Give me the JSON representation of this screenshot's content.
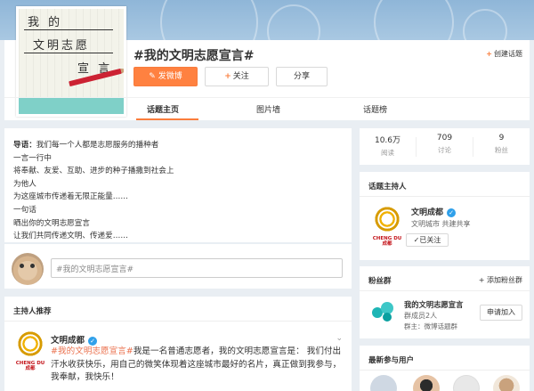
{
  "topic": {
    "title": "#我的文明志愿宣言#",
    "create_topic_label": "创建话题",
    "post_label": "发微博",
    "follow_label": "关注",
    "share_label": "分享",
    "cover_text": {
      "line1": "我 的",
      "line2": "文明志愿",
      "line3": "宣 言"
    }
  },
  "tabs": [
    {
      "label": "话题主页",
      "active": true
    },
    {
      "label": "图片墙",
      "active": false
    },
    {
      "label": "话题榜",
      "active": false
    }
  ],
  "intro": {
    "lead_label": "导语：",
    "lead_text": "我们每一个人都是志愿服务的播种者",
    "lines": [
      "一言一行中",
      "将奉献、友爱、互助、进步的种子播撒到社会上",
      "为他人",
      "为这座城市传递着无限正能量……",
      "一句话",
      "晒出你的文明志愿宣言",
      "让我们共同传递文明、传递爱……"
    ]
  },
  "compose": {
    "placeholder": "#我的文明志愿宣言#"
  },
  "host_recommend": {
    "title": "主持人推荐",
    "user": "文明成都",
    "logo_text": "CHENG DU 成都",
    "hashtag": "#我的文明志愿宣言#",
    "body": "我是一名普通志愿者，我的文明志愿宣言是： 我们付出汗水收获快乐，用自己的微笑体现着这座城市最好的名片，真正做到我参与，我奉献，我快乐！"
  },
  "stats": [
    {
      "num": "10.6万",
      "label": "阅读"
    },
    {
      "num": "709",
      "label": "讨论"
    },
    {
      "num": "9",
      "label": "粉丝"
    }
  ],
  "host": {
    "title": "话题主持人",
    "name": "文明成都",
    "desc": "文明城市 共建共享",
    "followed_label": "已关注"
  },
  "fans": {
    "title": "粉丝群",
    "add_label": "添加粉丝群",
    "group_name": "我的文明志愿宣言",
    "members": "群成员2人",
    "owner": "群主：微博话题群",
    "join_label": "申请加入"
  },
  "recent": {
    "title": "最新参与用户"
  },
  "colors": {
    "accent": "#ff8140",
    "link": "#eb7350",
    "verify": "#2fa0ea"
  }
}
